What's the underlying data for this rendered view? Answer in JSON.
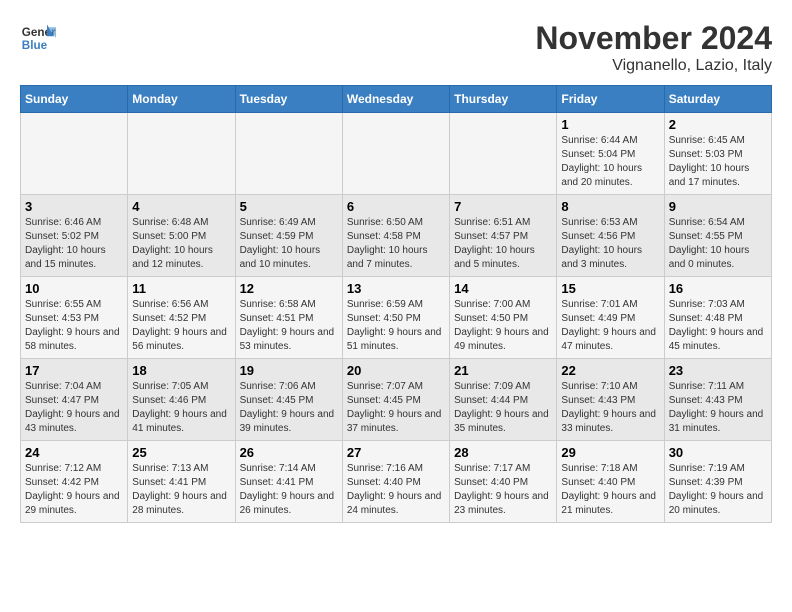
{
  "logo": {
    "text_general": "General",
    "text_blue": "Blue"
  },
  "title": "November 2024",
  "location": "Vignanello, Lazio, Italy",
  "weekdays": [
    "Sunday",
    "Monday",
    "Tuesday",
    "Wednesday",
    "Thursday",
    "Friday",
    "Saturday"
  ],
  "weeks": [
    [
      {
        "day": "",
        "info": ""
      },
      {
        "day": "",
        "info": ""
      },
      {
        "day": "",
        "info": ""
      },
      {
        "day": "",
        "info": ""
      },
      {
        "day": "",
        "info": ""
      },
      {
        "day": "1",
        "info": "Sunrise: 6:44 AM\nSunset: 5:04 PM\nDaylight: 10 hours and 20 minutes."
      },
      {
        "day": "2",
        "info": "Sunrise: 6:45 AM\nSunset: 5:03 PM\nDaylight: 10 hours and 17 minutes."
      }
    ],
    [
      {
        "day": "3",
        "info": "Sunrise: 6:46 AM\nSunset: 5:02 PM\nDaylight: 10 hours and 15 minutes."
      },
      {
        "day": "4",
        "info": "Sunrise: 6:48 AM\nSunset: 5:00 PM\nDaylight: 10 hours and 12 minutes."
      },
      {
        "day": "5",
        "info": "Sunrise: 6:49 AM\nSunset: 4:59 PM\nDaylight: 10 hours and 10 minutes."
      },
      {
        "day": "6",
        "info": "Sunrise: 6:50 AM\nSunset: 4:58 PM\nDaylight: 10 hours and 7 minutes."
      },
      {
        "day": "7",
        "info": "Sunrise: 6:51 AM\nSunset: 4:57 PM\nDaylight: 10 hours and 5 minutes."
      },
      {
        "day": "8",
        "info": "Sunrise: 6:53 AM\nSunset: 4:56 PM\nDaylight: 10 hours and 3 minutes."
      },
      {
        "day": "9",
        "info": "Sunrise: 6:54 AM\nSunset: 4:55 PM\nDaylight: 10 hours and 0 minutes."
      }
    ],
    [
      {
        "day": "10",
        "info": "Sunrise: 6:55 AM\nSunset: 4:53 PM\nDaylight: 9 hours and 58 minutes."
      },
      {
        "day": "11",
        "info": "Sunrise: 6:56 AM\nSunset: 4:52 PM\nDaylight: 9 hours and 56 minutes."
      },
      {
        "day": "12",
        "info": "Sunrise: 6:58 AM\nSunset: 4:51 PM\nDaylight: 9 hours and 53 minutes."
      },
      {
        "day": "13",
        "info": "Sunrise: 6:59 AM\nSunset: 4:50 PM\nDaylight: 9 hours and 51 minutes."
      },
      {
        "day": "14",
        "info": "Sunrise: 7:00 AM\nSunset: 4:50 PM\nDaylight: 9 hours and 49 minutes."
      },
      {
        "day": "15",
        "info": "Sunrise: 7:01 AM\nSunset: 4:49 PM\nDaylight: 9 hours and 47 minutes."
      },
      {
        "day": "16",
        "info": "Sunrise: 7:03 AM\nSunset: 4:48 PM\nDaylight: 9 hours and 45 minutes."
      }
    ],
    [
      {
        "day": "17",
        "info": "Sunrise: 7:04 AM\nSunset: 4:47 PM\nDaylight: 9 hours and 43 minutes."
      },
      {
        "day": "18",
        "info": "Sunrise: 7:05 AM\nSunset: 4:46 PM\nDaylight: 9 hours and 41 minutes."
      },
      {
        "day": "19",
        "info": "Sunrise: 7:06 AM\nSunset: 4:45 PM\nDaylight: 9 hours and 39 minutes."
      },
      {
        "day": "20",
        "info": "Sunrise: 7:07 AM\nSunset: 4:45 PM\nDaylight: 9 hours and 37 minutes."
      },
      {
        "day": "21",
        "info": "Sunrise: 7:09 AM\nSunset: 4:44 PM\nDaylight: 9 hours and 35 minutes."
      },
      {
        "day": "22",
        "info": "Sunrise: 7:10 AM\nSunset: 4:43 PM\nDaylight: 9 hours and 33 minutes."
      },
      {
        "day": "23",
        "info": "Sunrise: 7:11 AM\nSunset: 4:43 PM\nDaylight: 9 hours and 31 minutes."
      }
    ],
    [
      {
        "day": "24",
        "info": "Sunrise: 7:12 AM\nSunset: 4:42 PM\nDaylight: 9 hours and 29 minutes."
      },
      {
        "day": "25",
        "info": "Sunrise: 7:13 AM\nSunset: 4:41 PM\nDaylight: 9 hours and 28 minutes."
      },
      {
        "day": "26",
        "info": "Sunrise: 7:14 AM\nSunset: 4:41 PM\nDaylight: 9 hours and 26 minutes."
      },
      {
        "day": "27",
        "info": "Sunrise: 7:16 AM\nSunset: 4:40 PM\nDaylight: 9 hours and 24 minutes."
      },
      {
        "day": "28",
        "info": "Sunrise: 7:17 AM\nSunset: 4:40 PM\nDaylight: 9 hours and 23 minutes."
      },
      {
        "day": "29",
        "info": "Sunrise: 7:18 AM\nSunset: 4:40 PM\nDaylight: 9 hours and 21 minutes."
      },
      {
        "day": "30",
        "info": "Sunrise: 7:19 AM\nSunset: 4:39 PM\nDaylight: 9 hours and 20 minutes."
      }
    ]
  ]
}
